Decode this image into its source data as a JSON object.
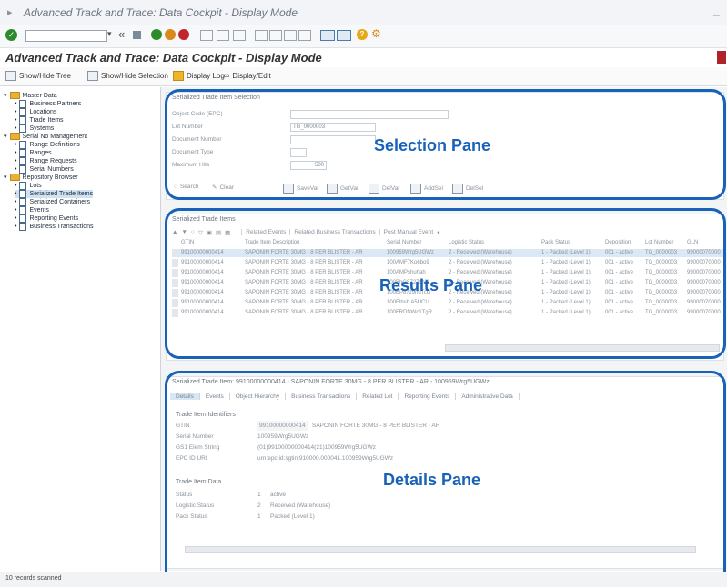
{
  "window": {
    "title": "Advanced Track and Trace: Data Cockpit - Display Mode"
  },
  "page_title": "Advanced Track and Trace: Data Cockpit - Display Mode",
  "app_toolbar": {
    "show_hide_tree": "Show/Hide Tree",
    "show_hide_selection": "Show/Hide Selection",
    "display_log": "Display Log",
    "display_edit": "Display/Edit"
  },
  "tree": {
    "groups": [
      {
        "label": "Master Data",
        "items": [
          "Business Partners",
          "Locations",
          "Trade Items",
          "Systems"
        ]
      },
      {
        "label": "Serial No Management",
        "items": [
          "Range Definitions",
          "Ranges",
          "Range Requests",
          "Serial Numbers"
        ]
      },
      {
        "label": "Repository Browser",
        "items": [
          "Lots",
          "Serialized Trade Items",
          "Serialized Containers",
          "Events",
          "Reporting Events",
          "Business Transactions"
        ]
      }
    ],
    "selected": "Serialized Trade Items"
  },
  "selection_pane": {
    "header": "Serialized Trade Item Selection",
    "fields": [
      {
        "label": "Object Code (EPC)",
        "value": ""
      },
      {
        "label": "Lot Number",
        "value": "TG_0000003"
      },
      {
        "label": "Document Number",
        "value": ""
      },
      {
        "label": "Document Type",
        "value": ""
      },
      {
        "label": "Maximum Hits",
        "value": "500"
      }
    ],
    "buttons": [
      "Search",
      "Clear",
      "SaveVar",
      "GetVar",
      "DelVar",
      "AddSel",
      "DelSel"
    ]
  },
  "results_pane": {
    "header": "Serialized Trade Items",
    "toolbar_buttons": [
      "Related Events",
      "Related Business Transactions",
      "Post Manual Event"
    ],
    "columns": [
      "GTIN",
      "Trade Item Description",
      "Serial Number",
      "Logistic Status",
      "Pack Status",
      "Deposition",
      "Lot Number",
      "GLN"
    ],
    "rows": [
      [
        "99100000000414",
        "SAPONIN FORTE 30MG - 8 PER BLISTER - AR",
        "100959Wrg5UGWz",
        "2 - Received (Warehouse)",
        "1 - Packed (Level 1)",
        "001 - active",
        "TG_0000003",
        "99000070000"
      ],
      [
        "99100000000414",
        "SAPONIN FORTE 30MG - 8 PER BLISTER - AR",
        "100AMF7Ko6bo9",
        "2 - Received (Warehouse)",
        "1 - Packed (Level 1)",
        "001 - active",
        "TG_0000003",
        "99000070000"
      ],
      [
        "99100000000414",
        "SAPONIN FORTE 30MG - 8 PER BLISTER - AR",
        "100AMPshuhah",
        "2 - Received (Warehouse)",
        "1 - Packed (Level 1)",
        "001 - active",
        "TG_0000003",
        "99000070000"
      ],
      [
        "99100000000414",
        "SAPONIN FORTE 30MG - 8 PER BLISTER - AR",
        "100BhG8Z2TchN",
        "2 - Received (Warehouse)",
        "1 - Packed (Level 1)",
        "001 - active",
        "TG_0000003",
        "99000070000"
      ],
      [
        "99100000000414",
        "SAPONIN FORTE 30MG - 8 PER BLISTER - AR",
        "100EP87z9nuTcG",
        "2 - Received (Warehouse)",
        "1 - Packed (Level 1)",
        "001 - active",
        "TG_0000003",
        "99000070000"
      ],
      [
        "99100000000414",
        "SAPONIN FORTE 30MG - 8 PER BLISTER - AR",
        "100Elhsh A5UCU",
        "2 - Received (Warehouse)",
        "1 - Packed (Level 1)",
        "001 - active",
        "TG_0000003",
        "99000070000"
      ],
      [
        "99100000000414",
        "SAPONIN FORTE 30MG - 8 PER BLISTER - AR",
        "100FRDNWc1TgR",
        "2 - Received (Warehouse)",
        "1 - Packed (Level 1)",
        "001 - active",
        "TG_0000003",
        "99000070000"
      ]
    ]
  },
  "details_pane": {
    "header": "Serialized Trade Item: 99100000000414 - SAPONIN FORTE 30MG - 8 PER BLISTER - AR - 100959Wrg5UGWz",
    "tabs": [
      "Details",
      "Events",
      "Object Hierarchy",
      "Business Transactions",
      "Related Lot",
      "Reporting Events",
      "Administrative Data"
    ],
    "active_tab": "Details",
    "identifiers_title": "Trade Item Identifiers",
    "identifiers": [
      {
        "label": "GTIN",
        "value": "99100000000414",
        "extra": "SAPONIN FORTE 30MG - 8 PER BLISTER - AR"
      },
      {
        "label": "Serial Number",
        "value": "100959Wrg5UGWz",
        "extra": ""
      },
      {
        "label": "GS1 Elem String",
        "value": "(01)99100000000414(21)100959Wrg5UGWz",
        "extra": ""
      },
      {
        "label": "EPC ID URI",
        "value": "urn:epc:id:sgtin:910000.000041.100959Wrg5UGWz",
        "extra": ""
      }
    ],
    "data_title": "Trade Item Data",
    "data": [
      {
        "label": "Status",
        "code": "1",
        "value": "active"
      },
      {
        "label": "Logistic Status",
        "code": "2",
        "value": "Received (Warehouse)"
      },
      {
        "label": "Pack Status",
        "code": "1",
        "value": "Packed (Level 1)"
      }
    ]
  },
  "callouts": {
    "selection": "Selection Pane",
    "results": "Results Pane",
    "details": "Details Pane"
  },
  "status_bar": {
    "text": "10 records scanned"
  },
  "colors": {
    "callout": "#1862b8",
    "folder": "#e8b23a",
    "selected_row": "#cfe2f3"
  }
}
